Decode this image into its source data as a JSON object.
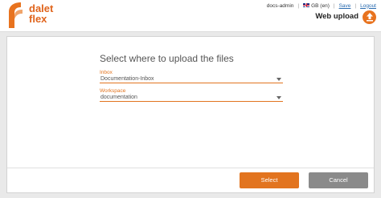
{
  "header": {
    "logo_line1": "dalet",
    "logo_line2": "flex",
    "user": "docs-admin",
    "language": "GB (en)",
    "links": [
      "Save",
      "Logout"
    ],
    "page_title": "Web upload"
  },
  "dialog": {
    "title": "Select where to upload the files",
    "inbox": {
      "label": "Inbox",
      "value": "Documentation-Inbox"
    },
    "workspace": {
      "label": "Workspace",
      "value": "documentation"
    },
    "select_label": "Select",
    "cancel_label": "Cancel"
  },
  "colors": {
    "accent": "#e2741f",
    "cancel": "#8a8a8a"
  },
  "icons": [
    "dalet-flex-logo",
    "uk-flag-icon",
    "upload-icon",
    "dropdown-caret-icon"
  ]
}
